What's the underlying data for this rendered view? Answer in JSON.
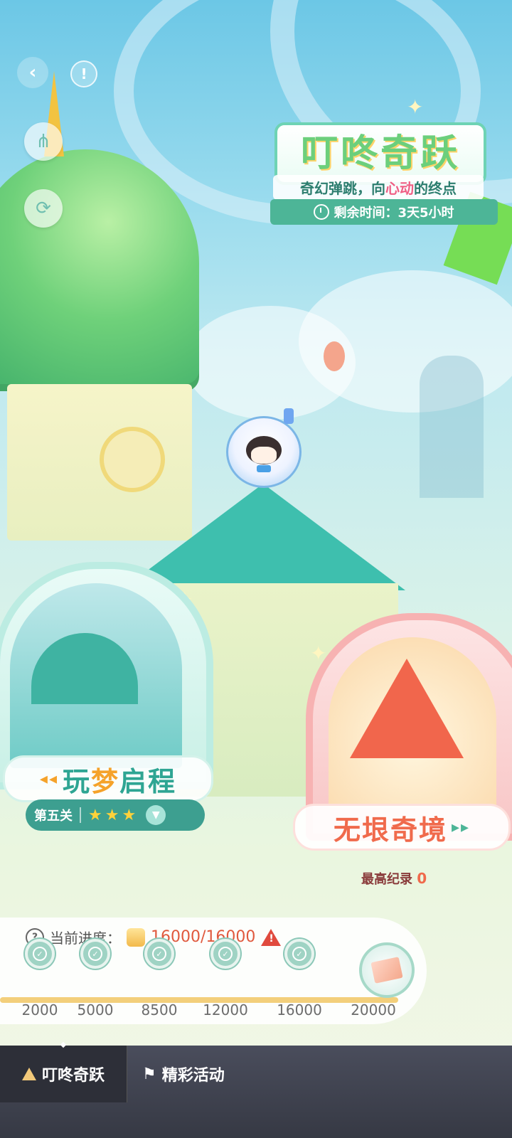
{
  "header": {
    "back_icon": "back-chevron-icon",
    "info_icon": "info-icon",
    "share_icon": "share-icon",
    "refresh_icon": "refresh-avatar-icon"
  },
  "event": {
    "title": "叮咚奇跃",
    "subtitle_prefix": "奇幻弹跳，向",
    "subtitle_highlight": "心动",
    "subtitle_suffix": "的终点",
    "timer_label": "剩余时间：3天5小时"
  },
  "modes": {
    "left": {
      "title_a": "玩",
      "title_b": "梦",
      "title_c": "启程",
      "level": "第五关",
      "stars": 3
    },
    "right": {
      "title": "无垠奇境",
      "record_label": "最高纪录",
      "record_value": "0"
    }
  },
  "progress": {
    "label": "当前进度：",
    "current": "16000/16000",
    "milestones": [
      "2000",
      "5000",
      "8500",
      "12000",
      "16000",
      "20000"
    ],
    "completed_count": 5,
    "fill_fraction": 0.8
  },
  "bottom_nav": {
    "tabs": [
      {
        "label": "叮咚奇跃",
        "active": true
      },
      {
        "label": "精彩活动",
        "active": false
      }
    ]
  },
  "colors": {
    "accent_green": "#4db597",
    "accent_orange": "#f5a22a",
    "accent_red": "#e0593e",
    "nav_bg": "#363944"
  }
}
